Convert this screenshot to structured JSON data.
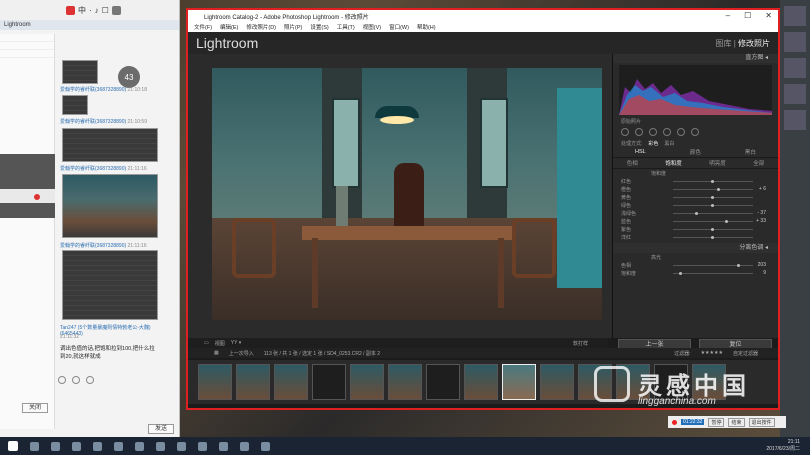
{
  "lightroom": {
    "window_title": "Lightroom Catalog-2 - Adobe Photoshop Lightroom - 修改照片",
    "menu": [
      "文件(F)",
      "编辑(E)",
      "修改照片(D)",
      "照片(P)",
      "设置(S)",
      "工具(T)",
      "视图(V)",
      "窗口(W)",
      "帮助(H)"
    ],
    "logo": "Lightroom",
    "modules": {
      "library": "图库",
      "separator": "|",
      "develop": "修改照片"
    },
    "panel": {
      "histogram_header": "直方图 ◂",
      "crop_row_label": "原始照片",
      "profile_label": "处理方式:",
      "profile_value": "彩色",
      "profile_alt": "黑白",
      "tabs": [
        "HSL",
        "颜色",
        "黑白"
      ],
      "subtabs": [
        "色相",
        "饱和度",
        "明亮度",
        "全部"
      ],
      "saturation_label": "饱和度",
      "hsl_rows": [
        {
          "label": "红色",
          "value": ""
        },
        {
          "label": "橙色",
          "value": "+ 6"
        },
        {
          "label": "黄色",
          "value": ""
        },
        {
          "label": "绿色",
          "value": ""
        },
        {
          "label": "浅绿色",
          "value": "- 37"
        },
        {
          "label": "蓝色",
          "value": "+ 33"
        },
        {
          "label": "紫色",
          "value": ""
        },
        {
          "label": "洋红",
          "value": ""
        }
      ],
      "section_split": "分离色调 ◂",
      "hl_label": "高光",
      "hue_label": "色相",
      "hue_value": "203",
      "sat_label": "饱和度",
      "sat_value": "9",
      "prev_btn": "上一张",
      "reset_btn": "复位"
    },
    "toolbar": {
      "view": "视图",
      "softproof": "软打样"
    },
    "filmbar": {
      "source": "上一次导入",
      "info": "113 张 / 共 1 张 / 选定 1 张 / SD4_0253.CR2 / 副本 2",
      "filter_label": "过滤器:",
      "filter_value": "自定过滤器"
    }
  },
  "chat": {
    "header_icons": [
      "中",
      "·",
      "♪",
      "☐"
    ],
    "title": "Lightroom",
    "messages": [
      {
        "name": "爱翰学的睿纤联(3687328890)",
        "time": "21:10:18"
      },
      {
        "name": "爱翰学的睿纤联(3687328890)",
        "time": "21:10:59"
      },
      {
        "name": "爱翰学的睿纤联(3687328890)",
        "time": "21:11:16"
      },
      {
        "name": "Tan247 (5个数量暴魔则情特勃老公-大魏)(6465443)",
        "time": "21:11:32"
      }
    ],
    "circle_value": "43",
    "text_lines": [
      "调出色值的话,把饱和拉到100,把什么拉",
      "到20,就这样就成"
    ],
    "close_btn": "关闭",
    "send_btn": "发送"
  },
  "recorder": {
    "time": "01:22:32",
    "pause": "暂停",
    "stop": "结束",
    "exit": "退出按件"
  },
  "taskbar": {
    "time": "21:11",
    "date": "2017/6/23/周二"
  },
  "watermark": {
    "text": "灵感中国",
    "url": "lingganchina.com"
  }
}
